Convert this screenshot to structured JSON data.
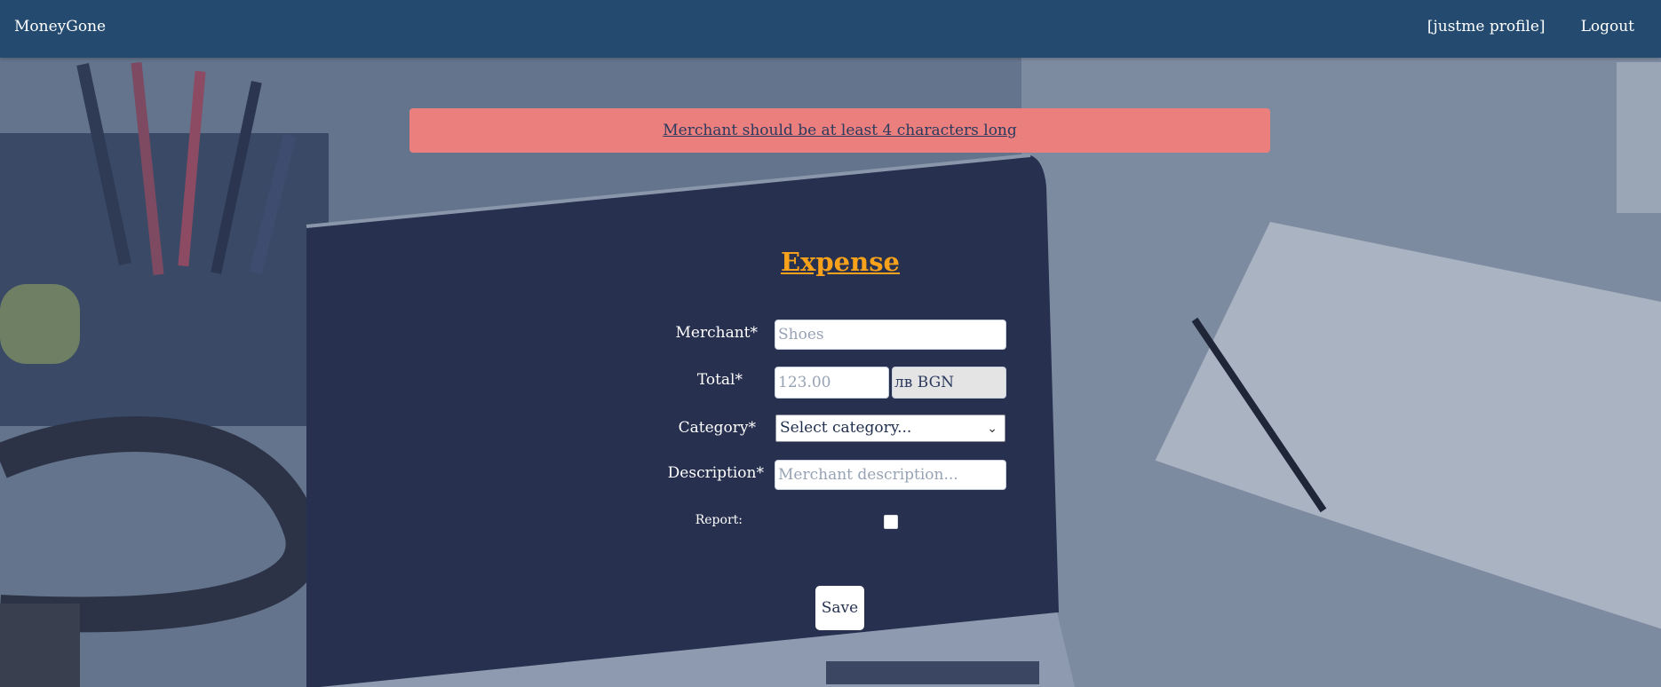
{
  "navbar": {
    "brand": "MoneyGone",
    "profile_link": "[justme profile]",
    "logout_link": "Logout"
  },
  "alert": {
    "message": "Merchant should be at least 4 characters long"
  },
  "form": {
    "title": "Expense",
    "merchant": {
      "label": "Merchant*",
      "placeholder": "Shoes",
      "value": ""
    },
    "total": {
      "label": "Total*",
      "placeholder": "123.00",
      "value": "",
      "currency": "лв BGN"
    },
    "category": {
      "label": "Category*",
      "selected": "Select category..."
    },
    "description": {
      "label": "Description*",
      "placeholder": "Merchant description...",
      "value": ""
    },
    "report": {
      "label": "Report:",
      "checked": false
    },
    "save_label": "Save"
  },
  "colors": {
    "navbar": "#244b6f",
    "alert": "#ea7f7d",
    "title": "#f7a21a",
    "laptop_screen": "#27304f"
  }
}
